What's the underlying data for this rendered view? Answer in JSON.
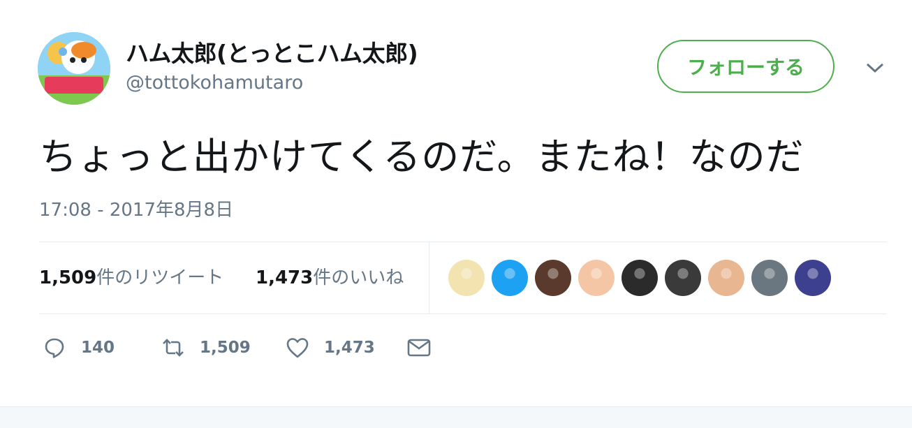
{
  "user": {
    "display_name": "ハム太郎(とっとこハム太郎)",
    "handle": "@tottokohamutaro",
    "avatar_text": "ハム太郎"
  },
  "follow_label": "フォローする",
  "tweet": {
    "text": "ちょっと出かけてくるのだ。またね！なのだ",
    "timestamp": "17:08 - 2017年8月8日"
  },
  "stats": {
    "retweets_count": "1,509",
    "retweets_label": "件のリツイート",
    "likes_count": "1,473",
    "likes_label": "件のいいね"
  },
  "likers": [
    {
      "color": "#f3e3b0"
    },
    {
      "color": "#1da1f2"
    },
    {
      "color": "#5a3a2c"
    },
    {
      "color": "#f5c6a5"
    },
    {
      "color": "#2b2b2b"
    },
    {
      "color": "#3a3a3a"
    },
    {
      "color": "#e8b690"
    },
    {
      "color": "#6b7780"
    },
    {
      "color": "#3d3f8f"
    }
  ],
  "actions": {
    "reply_count": "140",
    "retweet_count": "1,509",
    "like_count": "1,473"
  },
  "colors": {
    "follow_green": "#4cae4c",
    "secondary_text": "#657786",
    "divider": "#e6ecf0"
  }
}
